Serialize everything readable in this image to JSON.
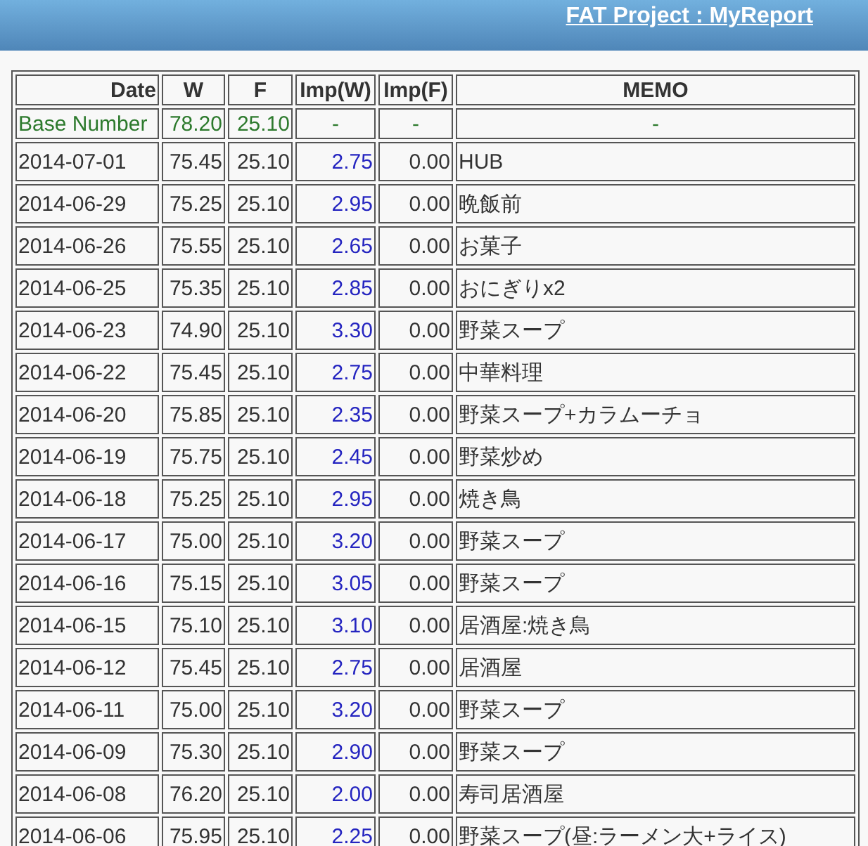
{
  "header": {
    "link": "FAT Project : MyReport"
  },
  "table": {
    "columns": [
      "Date",
      "W",
      "F",
      "Imp(W)",
      "Imp(F)",
      "MEMO"
    ],
    "rows": [
      {
        "kind": "base",
        "date": "Base Number",
        "w": "78.20",
        "f": "25.10",
        "imp_w": "-",
        "imp_f": "-",
        "memo": "-"
      },
      {
        "kind": "entry",
        "date": "2014-07-01",
        "w": "75.45",
        "f": "25.10",
        "imp_w": "2.75",
        "imp_f": "0.00",
        "memo": "HUB"
      },
      {
        "kind": "entry",
        "date": "2014-06-29",
        "w": "75.25",
        "f": "25.10",
        "imp_w": "2.95",
        "imp_f": "0.00",
        "memo": "晩飯前"
      },
      {
        "kind": "entry",
        "date": "2014-06-26",
        "w": "75.55",
        "f": "25.10",
        "imp_w": "2.65",
        "imp_f": "0.00",
        "memo": "お菓子"
      },
      {
        "kind": "entry",
        "date": "2014-06-25",
        "w": "75.35",
        "f": "25.10",
        "imp_w": "2.85",
        "imp_f": "0.00",
        "memo": "おにぎりx2"
      },
      {
        "kind": "entry",
        "date": "2014-06-23",
        "w": "74.90",
        "f": "25.10",
        "imp_w": "3.30",
        "imp_f": "0.00",
        "memo": "野菜スープ"
      },
      {
        "kind": "entry",
        "date": "2014-06-22",
        "w": "75.45",
        "f": "25.10",
        "imp_w": "2.75",
        "imp_f": "0.00",
        "memo": "中華料理"
      },
      {
        "kind": "entry",
        "date": "2014-06-20",
        "w": "75.85",
        "f": "25.10",
        "imp_w": "2.35",
        "imp_f": "0.00",
        "memo": "野菜スープ+カラムーチョ"
      },
      {
        "kind": "entry",
        "date": "2014-06-19",
        "w": "75.75",
        "f": "25.10",
        "imp_w": "2.45",
        "imp_f": "0.00",
        "memo": "野菜炒め"
      },
      {
        "kind": "entry",
        "date": "2014-06-18",
        "w": "75.25",
        "f": "25.10",
        "imp_w": "2.95",
        "imp_f": "0.00",
        "memo": "焼き鳥"
      },
      {
        "kind": "entry",
        "date": "2014-06-17",
        "w": "75.00",
        "f": "25.10",
        "imp_w": "3.20",
        "imp_f": "0.00",
        "memo": "野菜スープ"
      },
      {
        "kind": "entry",
        "date": "2014-06-16",
        "w": "75.15",
        "f": "25.10",
        "imp_w": "3.05",
        "imp_f": "0.00",
        "memo": "野菜スープ"
      },
      {
        "kind": "entry",
        "date": "2014-06-15",
        "w": "75.10",
        "f": "25.10",
        "imp_w": "3.10",
        "imp_f": "0.00",
        "memo": "居酒屋:焼き鳥"
      },
      {
        "kind": "entry",
        "date": "2014-06-12",
        "w": "75.45",
        "f": "25.10",
        "imp_w": "2.75",
        "imp_f": "0.00",
        "memo": "居酒屋"
      },
      {
        "kind": "entry",
        "date": "2014-06-11",
        "w": "75.00",
        "f": "25.10",
        "imp_w": "3.20",
        "imp_f": "0.00",
        "memo": "野菜スープ"
      },
      {
        "kind": "entry",
        "date": "2014-06-09",
        "w": "75.30",
        "f": "25.10",
        "imp_w": "2.90",
        "imp_f": "0.00",
        "memo": "野菜スープ"
      },
      {
        "kind": "entry",
        "date": "2014-06-08",
        "w": "76.20",
        "f": "25.10",
        "imp_w": "2.00",
        "imp_f": "0.00",
        "memo": "寿司居酒屋"
      },
      {
        "kind": "entry",
        "date": "2014-06-06",
        "w": "75.95",
        "f": "25.10",
        "imp_w": "2.25",
        "imp_f": "0.00",
        "memo": "野菜スープ(昼:ラーメン大+ライス)"
      }
    ]
  }
}
